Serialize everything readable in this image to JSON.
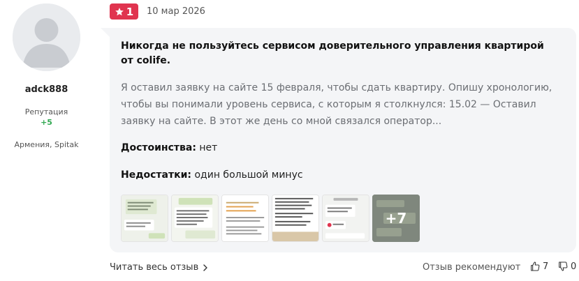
{
  "author": {
    "username": "adck888",
    "reputation_label": "Репутация",
    "reputation_value": "+5",
    "location": "Армения, Spitak",
    "avatar_icon": "user-avatar-placeholder"
  },
  "review": {
    "rating": "1",
    "rating_icon": "star-icon",
    "rating_color": "#e0344f",
    "date": "10 мар 2026",
    "title": "Никогда не пользуйтесь сервисом доверительного управления квартирой от colife.",
    "text": "Я оставил заявку на сайте 15 февраля, чтобы сдать квартиру. Опишу хронологию, чтобы вы понимали уровень сервиса, с которым я столкнулся: 15.02 — Оставил заявку на сайте. В этот же день со мной связался оператор...",
    "pros_label": "Достоинства:",
    "pros_value": "нет",
    "cons_label": "Недостатки:",
    "cons_value": "один большой минус",
    "more_photos": "+7"
  },
  "footer": {
    "read_more": "Читать весь отзыв",
    "recommend": "Отзыв рекомендуют",
    "likes": "7",
    "dislikes": "0"
  }
}
